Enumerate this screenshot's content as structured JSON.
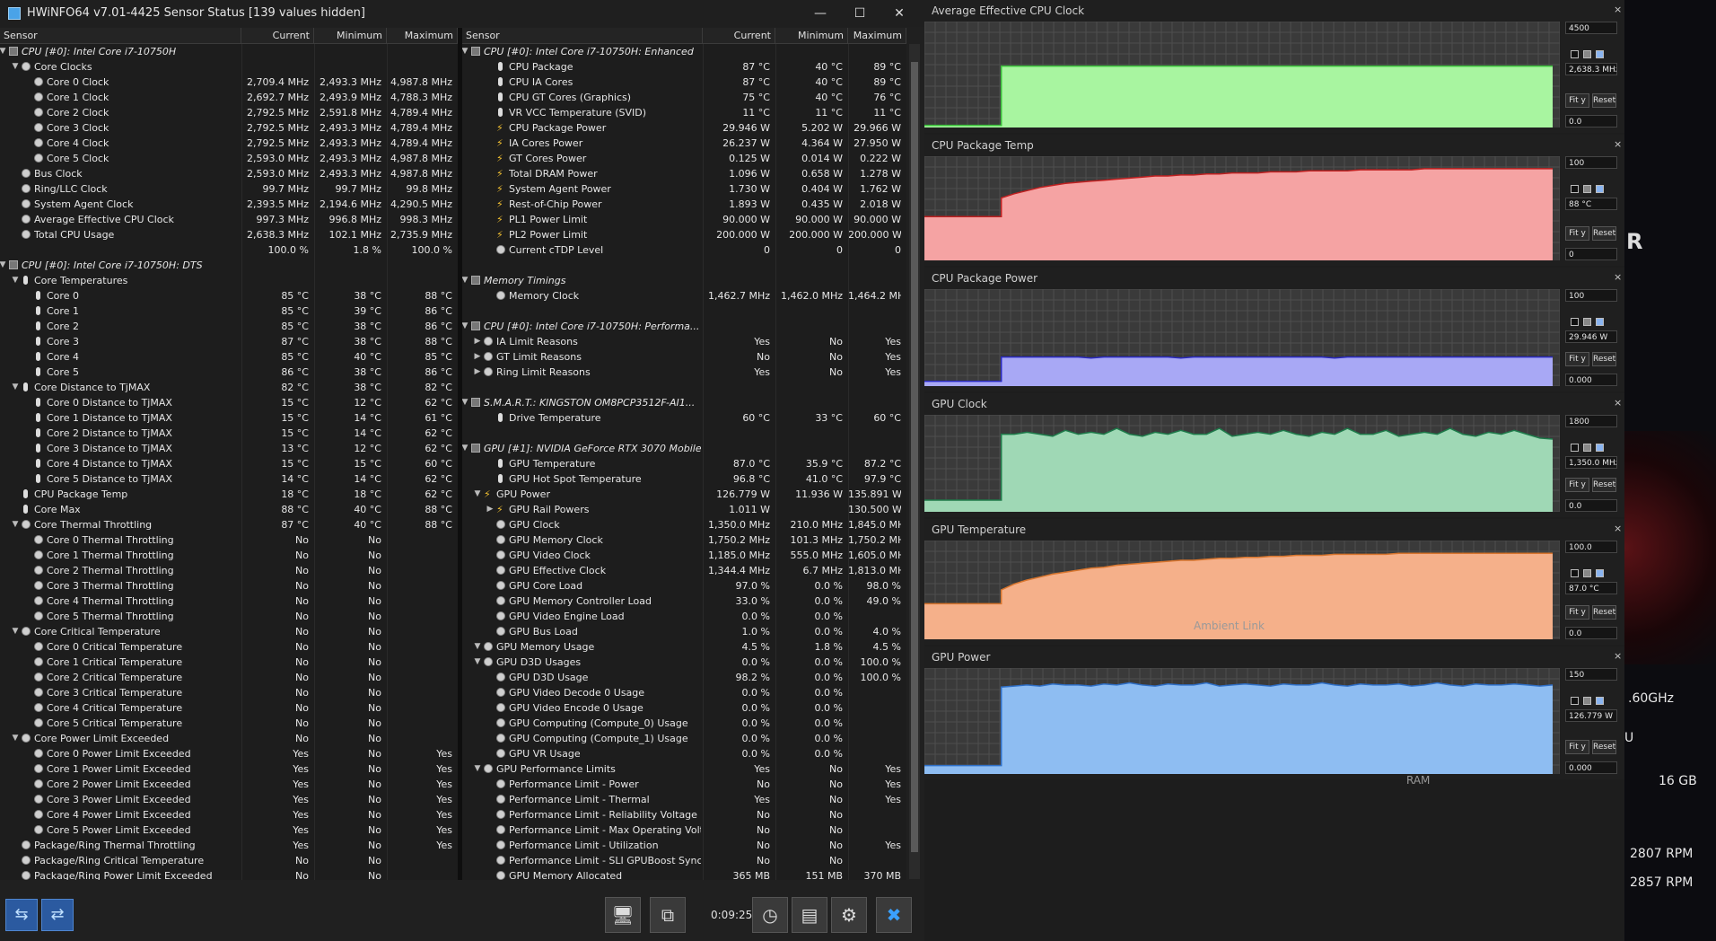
{
  "window": {
    "title": "HWiNFO64 v7.01-4425 Sensor Status [139 values hidden]"
  },
  "headers": {
    "sensor": "Sensor",
    "current": "Current",
    "minimum": "Minimum",
    "maximum": "Maximum"
  },
  "left_rows": [
    [
      "g",
      "CPU [#0]: Intel Core i7-10750H",
      "",
      "",
      "",
      "chip",
      "v"
    ],
    [
      "s",
      "Core Clocks",
      "",
      "",
      "",
      "circle",
      "v"
    ],
    [
      "i",
      "Core 0 Clock",
      "2,709.4 MHz",
      "2,493.3 MHz",
      "4,987.8 MHz",
      "circle",
      ""
    ],
    [
      "i",
      "Core 1 Clock",
      "2,692.7 MHz",
      "2,493.9 MHz",
      "4,788.3 MHz",
      "circle",
      ""
    ],
    [
      "i",
      "Core 2 Clock",
      "2,792.5 MHz",
      "2,591.8 MHz",
      "4,789.4 MHz",
      "circle",
      ""
    ],
    [
      "i",
      "Core 3 Clock",
      "2,792.5 MHz",
      "2,493.3 MHz",
      "4,789.4 MHz",
      "circle",
      ""
    ],
    [
      "i",
      "Core 4 Clock",
      "2,792.5 MHz",
      "2,493.3 MHz",
      "4,789.4 MHz",
      "circle",
      ""
    ],
    [
      "i",
      "Core 5 Clock",
      "2,593.0 MHz",
      "2,493.3 MHz",
      "4,987.8 MHz",
      "circle",
      ""
    ],
    [
      "s",
      "Bus Clock",
      "2,593.0 MHz",
      "2,493.3 MHz",
      "4,987.8 MHz",
      "circle",
      ""
    ],
    [
      "s",
      "Ring/LLC Clock",
      "99.7 MHz",
      "99.7 MHz",
      "99.8 MHz",
      "circle",
      ""
    ],
    [
      "s",
      "System Agent Clock",
      "2,393.5 MHz",
      "2,194.6 MHz",
      "4,290.5 MHz",
      "circle",
      ""
    ],
    [
      "s",
      "Average Effective CPU Clock",
      "997.3 MHz",
      "996.8 MHz",
      "998.3 MHz",
      "circle",
      ""
    ],
    [
      "s",
      "Total CPU Usage",
      "2,638.3 MHz",
      "102.1 MHz",
      "2,735.9 MHz",
      "circle",
      ""
    ],
    [
      "b",
      "",
      "100.0 %",
      "1.8 %",
      "100.0 %",
      "",
      ""
    ],
    [
      "g",
      "CPU [#0]: Intel Core i7-10750H: DTS",
      "",
      "",
      "",
      "chip",
      "v"
    ],
    [
      "s",
      "Core Temperatures",
      "",
      "",
      "",
      "therm",
      "v"
    ],
    [
      "i",
      "Core 0",
      "85 °C",
      "38 °C",
      "88 °C",
      "therm",
      ""
    ],
    [
      "i",
      "Core 1",
      "85 °C",
      "39 °C",
      "86 °C",
      "therm",
      ""
    ],
    [
      "i",
      "Core 2",
      "85 °C",
      "38 °C",
      "86 °C",
      "therm",
      ""
    ],
    [
      "i",
      "Core 3",
      "87 °C",
      "38 °C",
      "88 °C",
      "therm",
      ""
    ],
    [
      "i",
      "Core 4",
      "85 °C",
      "40 °C",
      "85 °C",
      "therm",
      ""
    ],
    [
      "i",
      "Core 5",
      "86 °C",
      "38 °C",
      "86 °C",
      "therm",
      ""
    ],
    [
      "s",
      "Core Distance to TjMAX",
      "82 °C",
      "38 °C",
      "82 °C",
      "therm",
      "v"
    ],
    [
      "i",
      "Core 0 Distance to TjMAX",
      "15 °C",
      "12 °C",
      "62 °C",
      "therm",
      ""
    ],
    [
      "i",
      "Core 1 Distance to TjMAX",
      "15 °C",
      "14 °C",
      "61 °C",
      "therm",
      ""
    ],
    [
      "i",
      "Core 2 Distance to TjMAX",
      "15 °C",
      "14 °C",
      "62 °C",
      "therm",
      ""
    ],
    [
      "i",
      "Core 3 Distance to TjMAX",
      "13 °C",
      "12 °C",
      "62 °C",
      "therm",
      ""
    ],
    [
      "i",
      "Core 4 Distance to TjMAX",
      "15 °C",
      "15 °C",
      "60 °C",
      "therm",
      ""
    ],
    [
      "i",
      "Core 5 Distance to TjMAX",
      "14 °C",
      "14 °C",
      "62 °C",
      "therm",
      ""
    ],
    [
      "s",
      "CPU Package Temp",
      "18 °C",
      "18 °C",
      "62 °C",
      "therm",
      ""
    ],
    [
      "s",
      "Core Max",
      "88 °C",
      "40 °C",
      "88 °C",
      "therm",
      ""
    ],
    [
      "s",
      "Core Thermal Throttling",
      "87 °C",
      "40 °C",
      "88 °C",
      "circle",
      "v"
    ],
    [
      "i",
      "Core 0 Thermal Throttling",
      "No",
      "No",
      "",
      "circle",
      ""
    ],
    [
      "i",
      "Core 1 Thermal Throttling",
      "No",
      "No",
      "",
      "circle",
      ""
    ],
    [
      "i",
      "Core 2 Thermal Throttling",
      "No",
      "No",
      "",
      "circle",
      ""
    ],
    [
      "i",
      "Core 3 Thermal Throttling",
      "No",
      "No",
      "",
      "circle",
      ""
    ],
    [
      "i",
      "Core 4 Thermal Throttling",
      "No",
      "No",
      "",
      "circle",
      ""
    ],
    [
      "i",
      "Core 5 Thermal Throttling",
      "No",
      "No",
      "",
      "circle",
      ""
    ],
    [
      "s",
      "Core Critical Temperature",
      "No",
      "No",
      "",
      "circle",
      "v"
    ],
    [
      "i",
      "Core 0 Critical Temperature",
      "No",
      "No",
      "",
      "circle",
      ""
    ],
    [
      "i",
      "Core 1 Critical Temperature",
      "No",
      "No",
      "",
      "circle",
      ""
    ],
    [
      "i",
      "Core 2 Critical Temperature",
      "No",
      "No",
      "",
      "circle",
      ""
    ],
    [
      "i",
      "Core 3 Critical Temperature",
      "No",
      "No",
      "",
      "circle",
      ""
    ],
    [
      "i",
      "Core 4 Critical Temperature",
      "No",
      "No",
      "",
      "circle",
      ""
    ],
    [
      "i",
      "Core 5 Critical Temperature",
      "No",
      "No",
      "",
      "circle",
      ""
    ],
    [
      "s",
      "Core Power Limit Exceeded",
      "No",
      "No",
      "",
      "circle",
      "v"
    ],
    [
      "i",
      "Core 0 Power Limit Exceeded",
      "Yes",
      "No",
      "Yes",
      "circle",
      ""
    ],
    [
      "i",
      "Core 1 Power Limit Exceeded",
      "Yes",
      "No",
      "Yes",
      "circle",
      ""
    ],
    [
      "i",
      "Core 2 Power Limit Exceeded",
      "Yes",
      "No",
      "Yes",
      "circle",
      ""
    ],
    [
      "i",
      "Core 3 Power Limit Exceeded",
      "Yes",
      "No",
      "Yes",
      "circle",
      ""
    ],
    [
      "i",
      "Core 4 Power Limit Exceeded",
      "Yes",
      "No",
      "Yes",
      "circle",
      ""
    ],
    [
      "i",
      "Core 5 Power Limit Exceeded",
      "Yes",
      "No",
      "Yes",
      "circle",
      ""
    ],
    [
      "s",
      "Package/Ring Thermal Throttling",
      "Yes",
      "No",
      "Yes",
      "circle",
      ""
    ],
    [
      "s",
      "Package/Ring Critical Temperature",
      "No",
      "No",
      "",
      "circle",
      ""
    ],
    [
      "s",
      "Package/Ring Power Limit Exceeded",
      "No",
      "No",
      "",
      "circle",
      ""
    ],
    [
      "b",
      "",
      "Yes",
      "No",
      "Yes",
      "",
      ""
    ]
  ],
  "right_rows": [
    [
      "g",
      "CPU [#0]: Intel Core i7-10750H: Enhanced",
      "",
      "",
      "",
      "chip",
      "v"
    ],
    [
      "i",
      "CPU Package",
      "87 °C",
      "40 °C",
      "89 °C",
      "therm",
      ""
    ],
    [
      "i",
      "CPU IA Cores",
      "87 °C",
      "40 °C",
      "89 °C",
      "therm",
      ""
    ],
    [
      "i",
      "CPU GT Cores (Graphics)",
      "75 °C",
      "40 °C",
      "76 °C",
      "therm",
      ""
    ],
    [
      "i",
      "VR VCC Temperature (SVID)",
      "11 °C",
      "11 °C",
      "11 °C",
      "therm",
      ""
    ],
    [
      "i",
      "CPU Package Power",
      "29.946 W",
      "5.202 W",
      "29.966 W",
      "bolt",
      ""
    ],
    [
      "i",
      "IA Cores Power",
      "26.237 W",
      "4.364 W",
      "27.950 W",
      "bolt",
      ""
    ],
    [
      "i",
      "GT Cores Power",
      "0.125 W",
      "0.014 W",
      "0.222 W",
      "bolt",
      ""
    ],
    [
      "i",
      "Total DRAM Power",
      "1.096 W",
      "0.658 W",
      "1.278 W",
      "bolt",
      ""
    ],
    [
      "i",
      "System Agent Power",
      "1.730 W",
      "0.404 W",
      "1.762 W",
      "bolt",
      ""
    ],
    [
      "i",
      "Rest-of-Chip Power",
      "1.893 W",
      "0.435 W",
      "2.018 W",
      "bolt",
      ""
    ],
    [
      "i",
      "PL1 Power Limit",
      "90.000 W",
      "90.000 W",
      "90.000 W",
      "bolt",
      ""
    ],
    [
      "i",
      "PL2 Power Limit",
      "200.000 W",
      "200.000 W",
      "200.000 W",
      "bolt",
      ""
    ],
    [
      "i",
      "Current cTDP Level",
      "0",
      "0",
      "0",
      "circle",
      ""
    ],
    [
      "b",
      "",
      "",
      "",
      "",
      "",
      ""
    ],
    [
      "g",
      "Memory Timings",
      "",
      "",
      "",
      "chip",
      "v"
    ],
    [
      "i",
      "Memory Clock",
      "1,462.7 MHz",
      "1,462.0 MHz",
      "1,464.2 MHz",
      "circle",
      ""
    ],
    [
      "b",
      "",
      "",
      "",
      "",
      "",
      ""
    ],
    [
      "g",
      "CPU [#0]: Intel Core i7-10750H: Performa...",
      "",
      "",
      "",
      "chip",
      "v"
    ],
    [
      "s",
      "IA Limit Reasons",
      "Yes",
      "No",
      "Yes",
      "circle",
      ">"
    ],
    [
      "s",
      "GT Limit Reasons",
      "No",
      "No",
      "Yes",
      "circle",
      ">"
    ],
    [
      "s",
      "Ring Limit Reasons",
      "Yes",
      "No",
      "Yes",
      "circle",
      ">"
    ],
    [
      "b",
      "",
      "",
      "",
      "",
      "",
      ""
    ],
    [
      "g",
      "S.M.A.R.T.: KINGSTON OM8PCP3512F-AI1...",
      "",
      "",
      "",
      "chip",
      "v"
    ],
    [
      "i",
      "Drive Temperature",
      "60 °C",
      "33 °C",
      "60 °C",
      "therm",
      ""
    ],
    [
      "b",
      "",
      "",
      "",
      "",
      "",
      ""
    ],
    [
      "g",
      "GPU [#1]: NVIDIA GeForce RTX 3070 Mobile:",
      "",
      "",
      "",
      "chip",
      "v"
    ],
    [
      "i",
      "GPU Temperature",
      "87.0 °C",
      "35.9 °C",
      "87.2 °C",
      "therm",
      ""
    ],
    [
      "i",
      "GPU Hot Spot Temperature",
      "96.8 °C",
      "41.0 °C",
      "97.9 °C",
      "therm",
      ""
    ],
    [
      "s",
      "GPU Power",
      "126.779 W",
      "11.936 W",
      "135.891 W",
      "bolt",
      "v"
    ],
    [
      "i",
      "GPU Rail Powers",
      "1.011 W",
      "",
      "130.500 W",
      "bolt",
      ">"
    ],
    [
      "i",
      "GPU Clock",
      "1,350.0 MHz",
      "210.0 MHz",
      "1,845.0 MHz",
      "circle",
      ""
    ],
    [
      "i",
      "GPU Memory Clock",
      "1,750.2 MHz",
      "101.3 MHz",
      "1,750.2 MHz",
      "circle",
      ""
    ],
    [
      "i",
      "GPU Video Clock",
      "1,185.0 MHz",
      "555.0 MHz",
      "1,605.0 MHz",
      "circle",
      ""
    ],
    [
      "i",
      "GPU Effective Clock",
      "1,344.4 MHz",
      "6.7 MHz",
      "1,813.0 MHz",
      "circle",
      ""
    ],
    [
      "i",
      "GPU Core Load",
      "97.0 %",
      "0.0 %",
      "98.0 %",
      "circle",
      ""
    ],
    [
      "i",
      "GPU Memory Controller Load",
      "33.0 %",
      "0.0 %",
      "49.0 %",
      "circle",
      ""
    ],
    [
      "i",
      "GPU Video Engine Load",
      "0.0 %",
      "0.0 %",
      "",
      "circle",
      ""
    ],
    [
      "i",
      "GPU Bus Load",
      "1.0 %",
      "0.0 %",
      "4.0 %",
      "circle",
      ""
    ],
    [
      "s",
      "GPU Memory Usage",
      "4.5 %",
      "1.8 %",
      "4.5 %",
      "circle",
      "v"
    ],
    [
      "s",
      "GPU D3D Usages",
      "0.0 %",
      "0.0 %",
      "100.0 %",
      "circle",
      "v"
    ],
    [
      "i",
      "GPU D3D Usage",
      "98.2 %",
      "0.0 %",
      "100.0 %",
      "circle",
      ""
    ],
    [
      "i",
      "GPU Video Decode 0 Usage",
      "0.0 %",
      "0.0 %",
      "",
      "circle",
      ""
    ],
    [
      "i",
      "GPU Video Encode 0 Usage",
      "0.0 %",
      "0.0 %",
      "",
      "circle",
      ""
    ],
    [
      "i",
      "GPU Computing (Compute_0) Usage",
      "0.0 %",
      "0.0 %",
      "",
      "circle",
      ""
    ],
    [
      "i",
      "GPU Computing (Compute_1) Usage",
      "0.0 %",
      "0.0 %",
      "",
      "circle",
      ""
    ],
    [
      "i",
      "GPU VR Usage",
      "0.0 %",
      "0.0 %",
      "",
      "circle",
      ""
    ],
    [
      "s",
      "GPU Performance Limits",
      "Yes",
      "No",
      "Yes",
      "circle",
      "v"
    ],
    [
      "i",
      "Performance Limit - Power",
      "No",
      "No",
      "Yes",
      "circle",
      ""
    ],
    [
      "i",
      "Performance Limit - Thermal",
      "Yes",
      "No",
      "Yes",
      "circle",
      ""
    ],
    [
      "i",
      "Performance Limit - Reliability Voltage",
      "No",
      "No",
      "",
      "circle",
      ""
    ],
    [
      "i",
      "Performance Limit - Max Operating Volt...",
      "No",
      "No",
      "",
      "circle",
      ""
    ],
    [
      "i",
      "Performance Limit - Utilization",
      "No",
      "No",
      "Yes",
      "circle",
      ""
    ],
    [
      "i",
      "Performance Limit - SLI GPUBoost Sync",
      "No",
      "No",
      "",
      "circle",
      ""
    ],
    [
      "i",
      "GPU Memory Allocated",
      "365 MB",
      "151 MB",
      "370 MB",
      "circle",
      ""
    ]
  ],
  "bottom": {
    "elapsed": "0:09:25"
  },
  "graphs": [
    {
      "title": "Average Effective CPU Clock",
      "top": "4500",
      "current": "2,638.3 MHz",
      "bottom": "0.0",
      "fill": "#a8f5a0",
      "line": "#38c038",
      "series": [
        0.02,
        0.02,
        0.02,
        0.02,
        0.02,
        0.02,
        0.58,
        0.58,
        0.58,
        0.58,
        0.58,
        0.58,
        0.58,
        0.58,
        0.58,
        0.58,
        0.58,
        0.58,
        0.58,
        0.58,
        0.58,
        0.58,
        0.58,
        0.58,
        0.58,
        0.58,
        0.58,
        0.58,
        0.58,
        0.58,
        0.58,
        0.58,
        0.58,
        0.58,
        0.58,
        0.58,
        0.58,
        0.58,
        0.58,
        0.58,
        0.58,
        0.58,
        0.58,
        0.58,
        0.58,
        0.58,
        0.58,
        0.58,
        0.58,
        0.58
      ]
    },
    {
      "title": "CPU Package Temp",
      "top": "100",
      "current": "88 °C",
      "bottom": "0",
      "fill": "#f5a3a3",
      "line": "#c02020",
      "series": [
        0.42,
        0.42,
        0.42,
        0.42,
        0.42,
        0.42,
        0.6,
        0.64,
        0.67,
        0.7,
        0.72,
        0.74,
        0.75,
        0.76,
        0.77,
        0.78,
        0.79,
        0.8,
        0.81,
        0.81,
        0.82,
        0.82,
        0.83,
        0.83,
        0.84,
        0.84,
        0.84,
        0.85,
        0.85,
        0.85,
        0.86,
        0.86,
        0.86,
        0.86,
        0.87,
        0.87,
        0.87,
        0.87,
        0.87,
        0.88,
        0.88,
        0.88,
        0.88,
        0.88,
        0.88,
        0.88,
        0.88,
        0.88,
        0.88,
        0.88
      ]
    },
    {
      "title": "CPU Package Power",
      "top": "100",
      "current": "29.946 W",
      "bottom": "0.000",
      "fill": "#a8a8f5",
      "line": "#2828c0",
      "series": [
        0.05,
        0.05,
        0.05,
        0.05,
        0.05,
        0.05,
        0.3,
        0.3,
        0.3,
        0.3,
        0.3,
        0.3,
        0.3,
        0.29,
        0.3,
        0.3,
        0.3,
        0.3,
        0.3,
        0.3,
        0.29,
        0.3,
        0.3,
        0.3,
        0.3,
        0.3,
        0.3,
        0.3,
        0.3,
        0.3,
        0.3,
        0.3,
        0.29,
        0.3,
        0.3,
        0.3,
        0.3,
        0.3,
        0.3,
        0.3,
        0.3,
        0.3,
        0.3,
        0.3,
        0.3,
        0.3,
        0.3,
        0.3,
        0.3,
        0.3
      ]
    },
    {
      "title": "GPU Clock",
      "top": "1800",
      "current": "1,350.0 MHz",
      "bottom": "0.0",
      "fill": "#9fd8b5",
      "line": "#1e7a4a",
      "series": [
        0.12,
        0.12,
        0.12,
        0.12,
        0.12,
        0.12,
        0.8,
        0.8,
        0.82,
        0.8,
        0.78,
        0.84,
        0.8,
        0.82,
        0.8,
        0.86,
        0.8,
        0.78,
        0.82,
        0.8,
        0.84,
        0.8,
        0.8,
        0.86,
        0.78,
        0.8,
        0.82,
        0.8,
        0.84,
        0.8,
        0.78,
        0.82,
        0.8,
        0.86,
        0.8,
        0.8,
        0.84,
        0.78,
        0.8,
        0.82,
        0.8,
        0.86,
        0.8,
        0.78,
        0.82,
        0.8,
        0.84,
        0.8,
        0.76,
        0.75
      ]
    },
    {
      "title": "GPU Temperature",
      "top": "100.0",
      "current": "87.0 °C",
      "bottom": "0.0",
      "fill": "#f5b08a",
      "line": "#d9762e",
      "series": [
        0.36,
        0.36,
        0.36,
        0.36,
        0.36,
        0.36,
        0.5,
        0.56,
        0.6,
        0.63,
        0.66,
        0.68,
        0.7,
        0.72,
        0.73,
        0.75,
        0.76,
        0.77,
        0.78,
        0.79,
        0.8,
        0.8,
        0.81,
        0.82,
        0.82,
        0.83,
        0.83,
        0.84,
        0.84,
        0.85,
        0.85,
        0.85,
        0.86,
        0.86,
        0.86,
        0.86,
        0.86,
        0.87,
        0.87,
        0.87,
        0.87,
        0.87,
        0.87,
        0.87,
        0.87,
        0.87,
        0.87,
        0.87,
        0.87,
        0.87
      ]
    },
    {
      "title": "GPU Power",
      "top": "150",
      "current": "126.779 W",
      "bottom": "0.000",
      "fill": "#8ebdf2",
      "line": "#2e6fc8",
      "series": [
        0.08,
        0.08,
        0.08,
        0.08,
        0.08,
        0.08,
        0.82,
        0.83,
        0.84,
        0.83,
        0.85,
        0.84,
        0.84,
        0.83,
        0.85,
        0.84,
        0.86,
        0.84,
        0.83,
        0.85,
        0.84,
        0.84,
        0.86,
        0.83,
        0.84,
        0.85,
        0.84,
        0.83,
        0.85,
        0.84,
        0.84,
        0.86,
        0.84,
        0.83,
        0.85,
        0.84,
        0.84,
        0.85,
        0.83,
        0.84,
        0.86,
        0.84,
        0.83,
        0.85,
        0.84,
        0.84,
        0.85,
        0.84,
        0.83,
        0.84
      ]
    }
  ],
  "graph_buttons": {
    "fit": "Fit y",
    "reset": "Reset"
  },
  "background": {
    "freq": ".60GHz",
    "u": "U",
    "ram_label": "RAM",
    "ram": "16 GB",
    "fan1": "2807 RPM",
    "fan2": "2857 RPM",
    "ambient": "Ambient Link"
  }
}
